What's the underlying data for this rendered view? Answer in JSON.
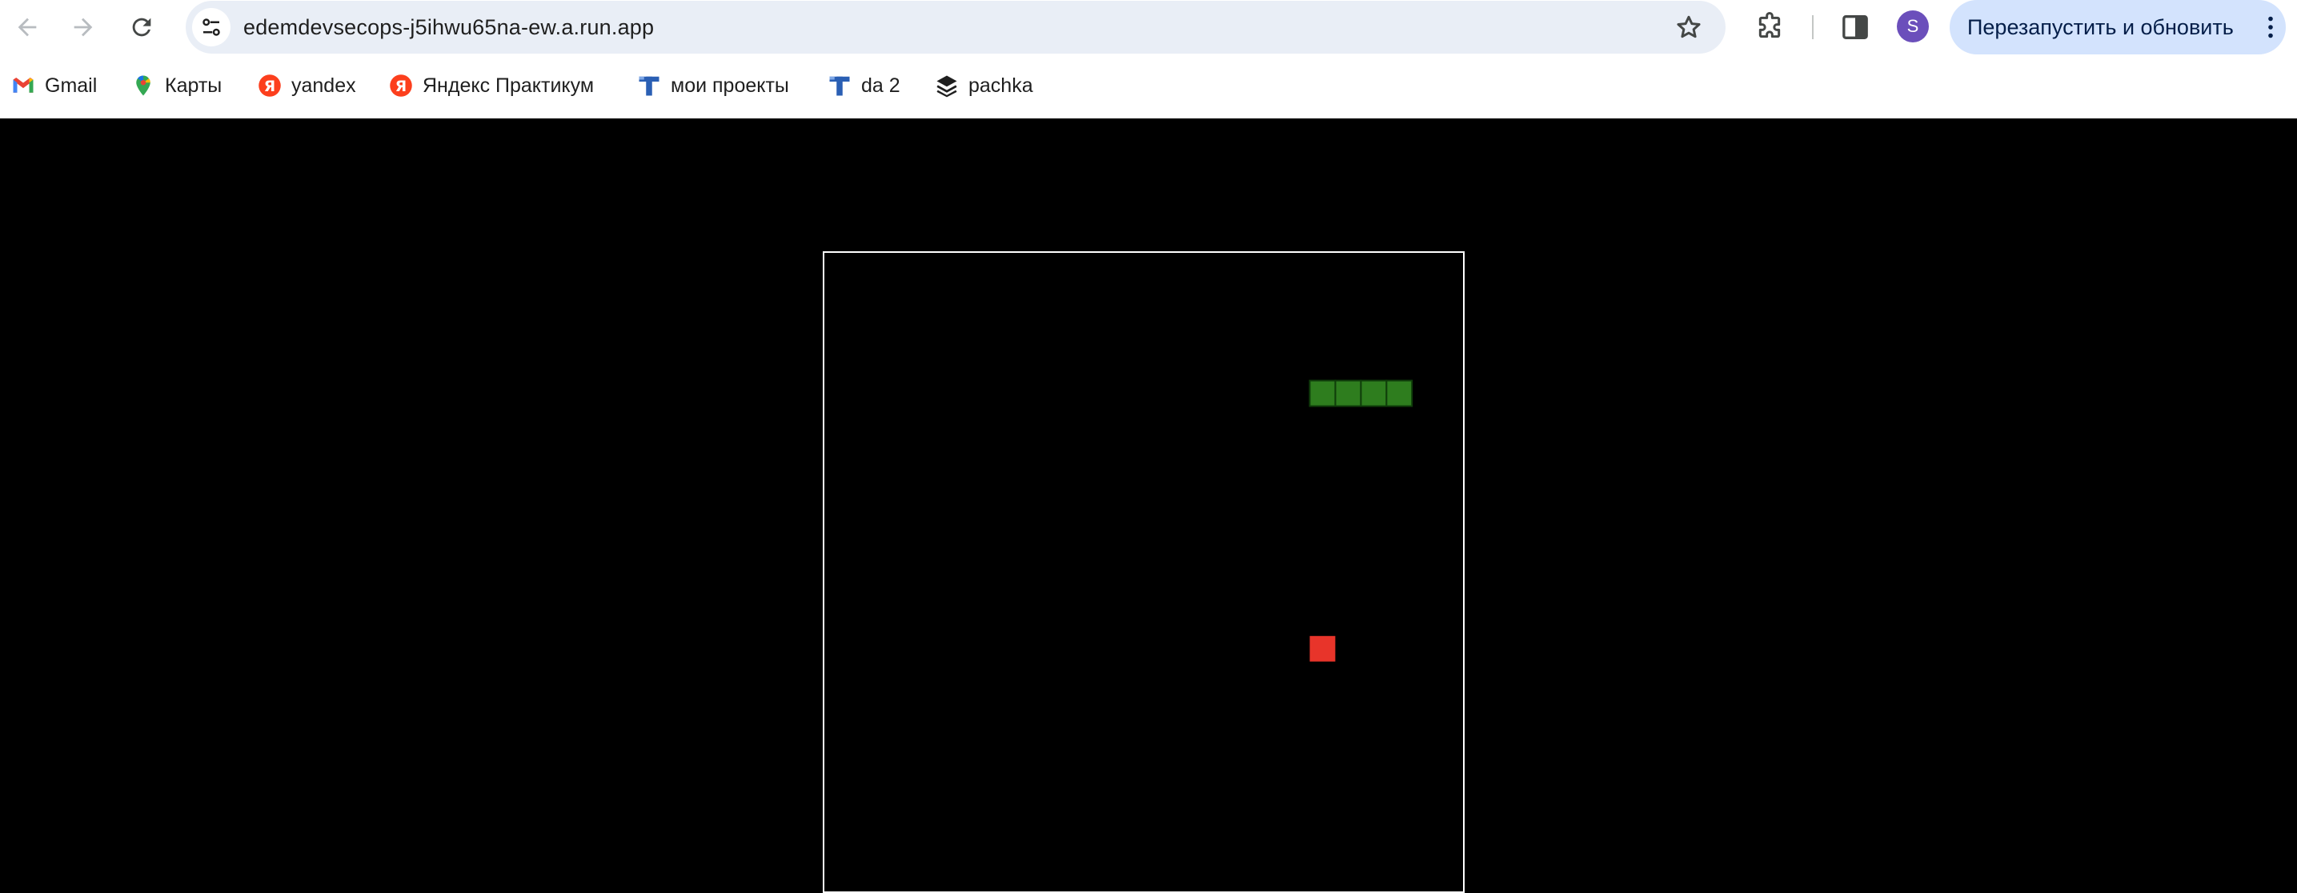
{
  "browser": {
    "url": "edemdevsecops-j5ihwu65na-ew.a.run.app",
    "update_button_label": "Перезапустить и обновить",
    "profile_initial": "S",
    "icons": {
      "back": "arrow-left-icon",
      "forward": "arrow-right-icon",
      "reload": "reload-icon",
      "site_info": "tune-icon",
      "bookmark": "star-icon",
      "extensions": "puzzle-icon",
      "side_panel": "side-panel-icon",
      "menu": "kebab-icon"
    }
  },
  "bookmarks": [
    {
      "label": "Gmail",
      "icon": "gmail-icon"
    },
    {
      "label": "Карты",
      "icon": "maps-pin-icon"
    },
    {
      "label": "yandex",
      "icon": "yandex-icon"
    },
    {
      "label": "Яндекс Практикум",
      "icon": "yandex-icon"
    },
    {
      "label": "мои проекты",
      "icon": "t-logo-icon"
    },
    {
      "label": "da 2",
      "icon": "t-logo-icon"
    },
    {
      "label": "pachka",
      "icon": "stack-icon"
    }
  ],
  "game": {
    "grid_cells": 25,
    "snake": [
      [
        22,
        5
      ],
      [
        21,
        5
      ],
      [
        20,
        5
      ],
      [
        19,
        5
      ]
    ],
    "food": [
      19,
      15
    ],
    "colors": {
      "background": "#000000",
      "border": "#ffffff",
      "snake": "#2e7d1e",
      "snake_outline": "#0f3d0a",
      "food": "#e8342a"
    }
  }
}
